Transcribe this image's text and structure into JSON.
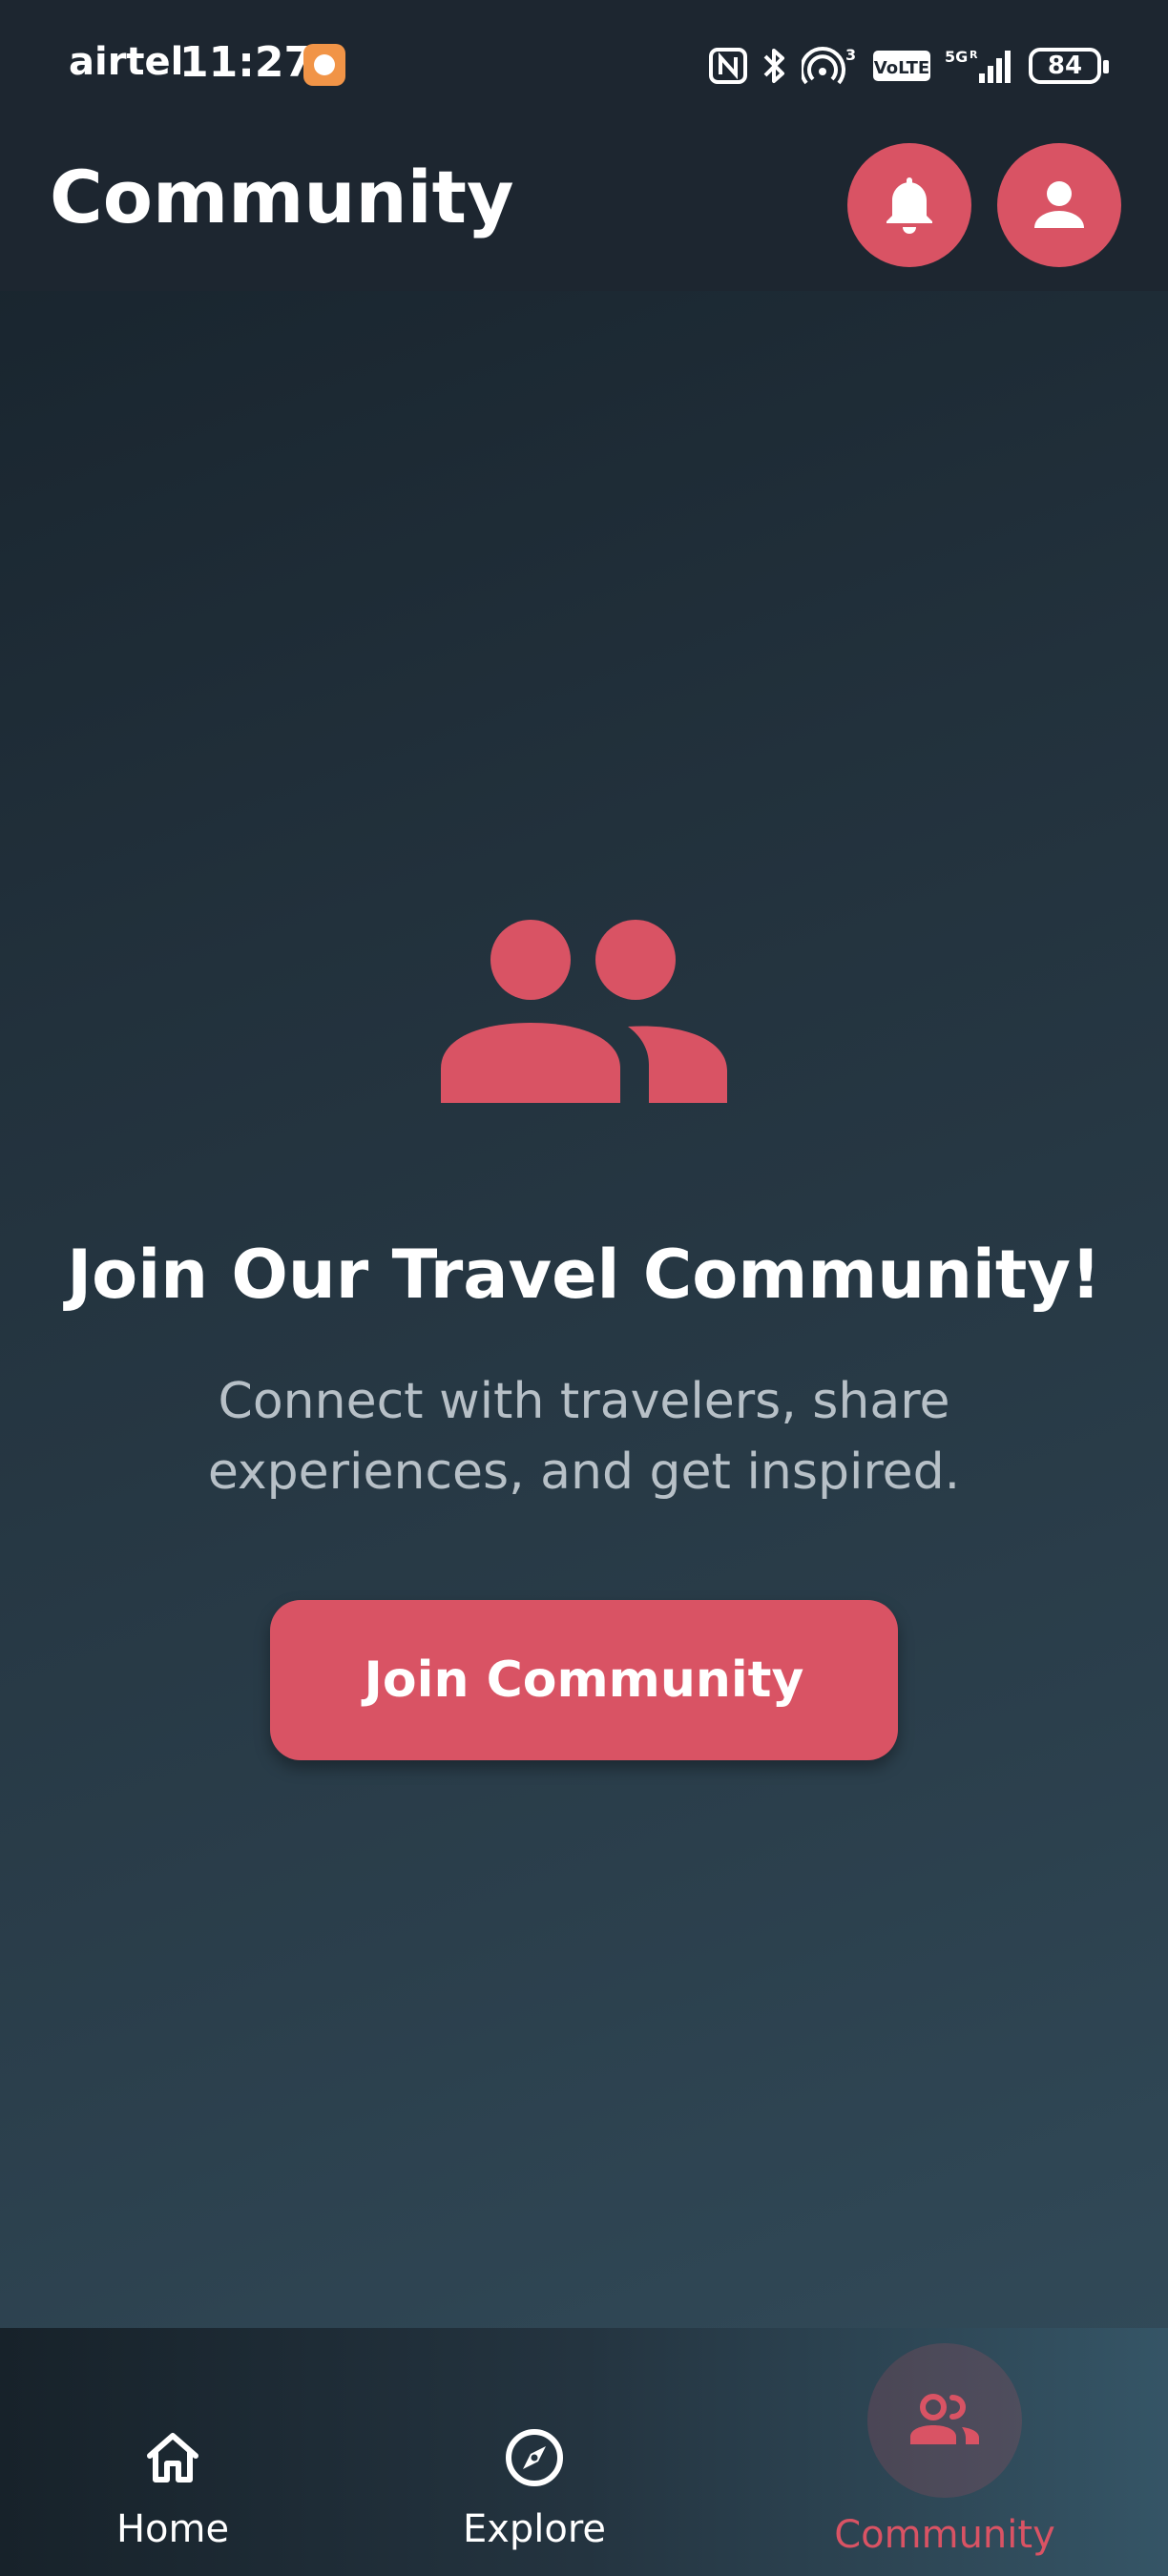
{
  "status_bar": {
    "carrier": "airtel",
    "time": "11:27",
    "battery": "84",
    "icons": [
      "app-notification-icon",
      "nfc-icon",
      "bluetooth-icon",
      "hotspot-icon",
      "volte-icon",
      "signal-5g-icon",
      "battery-icon"
    ]
  },
  "header": {
    "title": "Community",
    "notification_icon": "bell-icon",
    "profile_icon": "person-icon"
  },
  "main": {
    "icon": "group-icon",
    "title": "Join Our Travel Community!",
    "subtitle": "Connect with travelers, share experiences, and get inspired.",
    "button_label": "Join Community"
  },
  "bottom_nav": {
    "items": [
      {
        "label": "Home",
        "icon": "home-icon",
        "active": false
      },
      {
        "label": "Explore",
        "icon": "compass-icon",
        "active": false
      },
      {
        "label": "Community",
        "icon": "group-icon",
        "active": true
      }
    ]
  },
  "colors": {
    "accent": "#d95364",
    "bar_background": "#1d2630",
    "subtitle_text": "#b7c0c7"
  }
}
